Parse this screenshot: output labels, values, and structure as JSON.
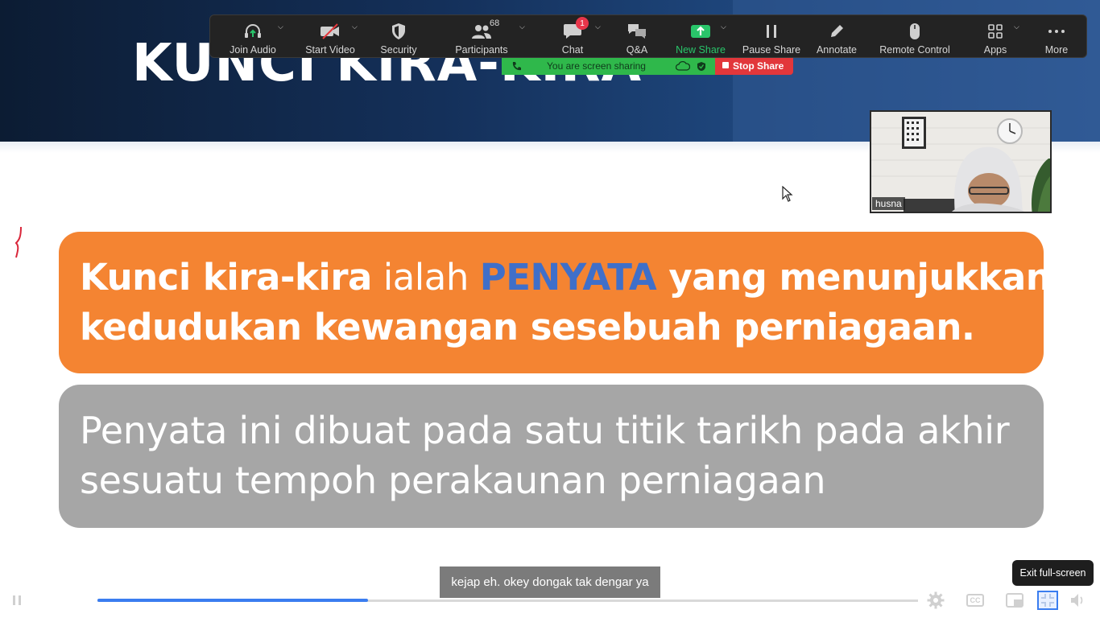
{
  "slide": {
    "title": "KUNCI KIRA-KIRA",
    "orange_box": {
      "line1_part1": "Kunci kira-kira",
      "line1_part2": " ialah ",
      "line1_part3": "PENYATA",
      "line1_part4": " yang menunjukkan",
      "line2": "kedudukan kewangan sesebuah perniagaan."
    },
    "grey_box": {
      "line1": "Penyata ini dibuat pada satu titik tarikh pada akhir",
      "line2": "sesuatu tempoh perakaunan perniagaan"
    }
  },
  "toolbar": {
    "items": [
      {
        "label": "Join Audio",
        "icon": "headphones-icon"
      },
      {
        "label": "Start Video",
        "icon": "video-off-icon"
      },
      {
        "label": "Security",
        "icon": "shield-icon"
      },
      {
        "label": "Participants",
        "icon": "participants-icon",
        "count": "68"
      },
      {
        "label": "Chat",
        "icon": "chat-icon",
        "badge": "1"
      },
      {
        "label": "Q&A",
        "icon": "qa-icon"
      },
      {
        "label": "New Share",
        "icon": "share-arrow-icon"
      },
      {
        "label": "Pause Share",
        "icon": "pause-icon"
      },
      {
        "label": "Annotate",
        "icon": "pencil-icon"
      },
      {
        "label": "Remote Control",
        "icon": "mouse-icon"
      },
      {
        "label": "Apps",
        "icon": "apps-icon"
      },
      {
        "label": "More",
        "icon": "more-icon"
      }
    ]
  },
  "sharing": {
    "status": "You are screen sharing",
    "stop_label": "Stop Share"
  },
  "video": {
    "participant_name": "husna"
  },
  "caption": {
    "text": "kejap eh. okey dongak tak dengar ya"
  },
  "player": {
    "progress": 0.33,
    "tooltip": "Exit full-screen"
  },
  "colors": {
    "orange": "#f48432",
    "grey": "#a6a6a6",
    "accent_blue": "#3f6fc9",
    "share_green": "#2fb84b",
    "stop_red": "#e2373b",
    "progress_blue": "#3a7df0"
  }
}
